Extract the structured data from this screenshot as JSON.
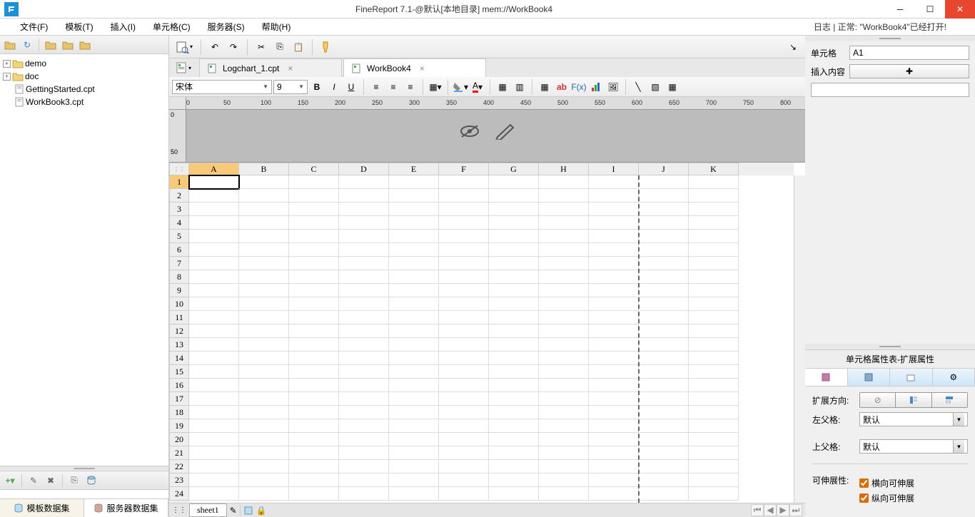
{
  "titlebar": {
    "title": "FineReport 7.1-@默认[本地目录]    mem://WorkBook4"
  },
  "menu": {
    "items": [
      "文件(F)",
      "模板(T)",
      "插入(I)",
      "单元格(C)",
      "服务器(S)",
      "帮助(H)"
    ],
    "status": "日志   |   正常: \"WorkBook4\"已经打开!"
  },
  "fileTree": {
    "folders": [
      "demo",
      "doc"
    ],
    "files": [
      "GettingStarted.cpt",
      "WorkBook3.cpt"
    ]
  },
  "datasetTabs": {
    "template": "模板数据集",
    "server": "服务器数据集"
  },
  "docTabs": [
    {
      "name": "Logchart_1.cpt",
      "active": false
    },
    {
      "name": "WorkBook4",
      "active": true
    }
  ],
  "format": {
    "font": "宋体",
    "size": "9"
  },
  "rulerH": [
    "0",
    "50",
    "100",
    "150",
    "200",
    "250",
    "300",
    "350",
    "400",
    "450",
    "500",
    "550",
    "600",
    "650",
    "700",
    "750",
    "800"
  ],
  "rulerV": [
    "0",
    "50"
  ],
  "grid": {
    "columns": [
      "A",
      "B",
      "C",
      "D",
      "E",
      "F",
      "G",
      "H",
      "I",
      "J",
      "K"
    ],
    "rows": 24,
    "selectedCell": "A1",
    "selectedCol": 0,
    "selectedRow": 0
  },
  "sheet": {
    "name": "sheet1"
  },
  "rightPanel": {
    "cellLabel": "单元格",
    "cellValue": "A1",
    "insertLabel": "插入内容",
    "panelTitle": "单元格属性表-扩展属性",
    "expandDirLabel": "扩展方向:",
    "leftParentLabel": "左父格:",
    "topParentLabel": "上父格:",
    "defaultOption": "默认",
    "stretchLabel": "可伸展性:",
    "stretchH": "横向可伸展",
    "stretchV": "纵向可伸展"
  }
}
